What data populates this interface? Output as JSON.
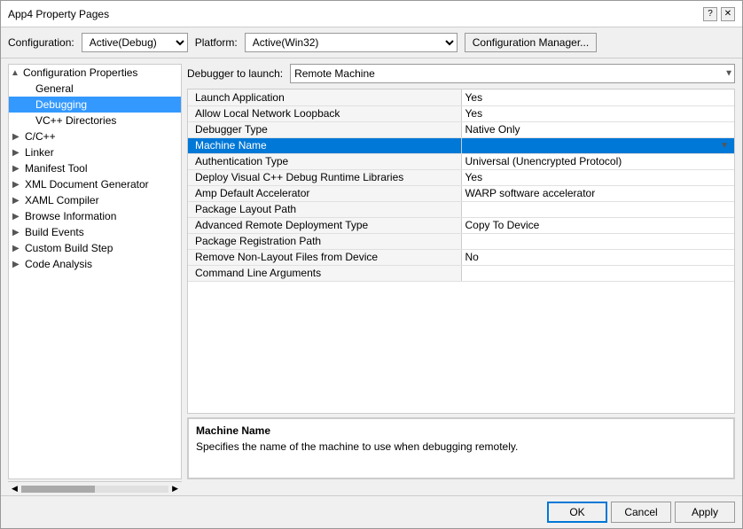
{
  "dialog": {
    "title": "App4 Property Pages",
    "title_btn_help": "?",
    "title_btn_close": "✕"
  },
  "config_bar": {
    "config_label": "Configuration:",
    "config_value": "Active(Debug)",
    "platform_label": "Platform:",
    "platform_value": "Active(Win32)",
    "manager_btn": "Configuration Manager..."
  },
  "sidebar": {
    "items": [
      {
        "id": "config-props",
        "label": "Configuration Properties",
        "indent": 0,
        "arrow": "▲",
        "has_arrow": true
      },
      {
        "id": "general",
        "label": "General",
        "indent": 1,
        "has_arrow": false
      },
      {
        "id": "debugging",
        "label": "Debugging",
        "indent": 1,
        "has_arrow": false,
        "selected": true
      },
      {
        "id": "vc-dirs",
        "label": "VC++ Directories",
        "indent": 1,
        "has_arrow": false
      },
      {
        "id": "c-cpp",
        "label": "C/C++",
        "indent": 0,
        "arrow": "▶",
        "has_arrow": true
      },
      {
        "id": "linker",
        "label": "Linker",
        "indent": 0,
        "arrow": "▶",
        "has_arrow": true
      },
      {
        "id": "manifest-tool",
        "label": "Manifest Tool",
        "indent": 0,
        "arrow": "▶",
        "has_arrow": true
      },
      {
        "id": "xml-doc-gen",
        "label": "XML Document Generator",
        "indent": 0,
        "arrow": "▶",
        "has_arrow": true
      },
      {
        "id": "xaml-compiler",
        "label": "XAML Compiler",
        "indent": 0,
        "arrow": "▶",
        "has_arrow": true
      },
      {
        "id": "browse-info",
        "label": "Browse Information",
        "indent": 0,
        "arrow": "▶",
        "has_arrow": true
      },
      {
        "id": "build-events",
        "label": "Build Events",
        "indent": 0,
        "arrow": "▶",
        "has_arrow": true
      },
      {
        "id": "custom-build",
        "label": "Custom Build Step",
        "indent": 0,
        "arrow": "▶",
        "has_arrow": true
      },
      {
        "id": "code-analysis",
        "label": "Code Analysis",
        "indent": 0,
        "arrow": "▶",
        "has_arrow": true
      }
    ]
  },
  "debugger_to_launch": {
    "label": "Debugger to launch:",
    "value": "Remote Machine"
  },
  "properties": [
    {
      "id": "section-local",
      "section": true,
      "name": "",
      "value": ""
    },
    {
      "id": "launch-app",
      "name": "Launch Application",
      "value": "Yes"
    },
    {
      "id": "allow-loopback",
      "name": "Allow Local Network Loopback",
      "value": "Yes"
    },
    {
      "id": "debugger-type",
      "name": "Debugger Type",
      "value": "Native Only"
    },
    {
      "id": "machine-name",
      "name": "Machine Name",
      "value": "",
      "highlighted": true,
      "has_dropdown": true
    },
    {
      "id": "auth-type",
      "name": "Authentication Type",
      "value": "Universal (Unencrypted Protocol)"
    },
    {
      "id": "deploy-libs",
      "name": "Deploy Visual C++ Debug Runtime Libraries",
      "value": "Yes"
    },
    {
      "id": "amp-accel",
      "name": "Amp Default Accelerator",
      "value": "WARP software accelerator"
    },
    {
      "id": "package-layout",
      "name": "Package Layout Path",
      "value": ""
    },
    {
      "id": "adv-remote",
      "name": "Advanced Remote Deployment Type",
      "value": "Copy To Device"
    },
    {
      "id": "pkg-reg-path",
      "name": "Package Registration Path",
      "value": ""
    },
    {
      "id": "remove-nonlayout",
      "name": "Remove Non-Layout Files from Device",
      "value": "No"
    },
    {
      "id": "cmd-args",
      "name": "Command Line Arguments",
      "value": ""
    }
  ],
  "info_panel": {
    "title": "Machine Name",
    "description": "Specifies the name of the machine to use when debugging remotely."
  },
  "bottom_buttons": {
    "ok": "OK",
    "cancel": "Cancel",
    "apply": "Apply"
  },
  "scrollbar": {
    "left_arrow": "◀",
    "right_arrow": "▶"
  }
}
